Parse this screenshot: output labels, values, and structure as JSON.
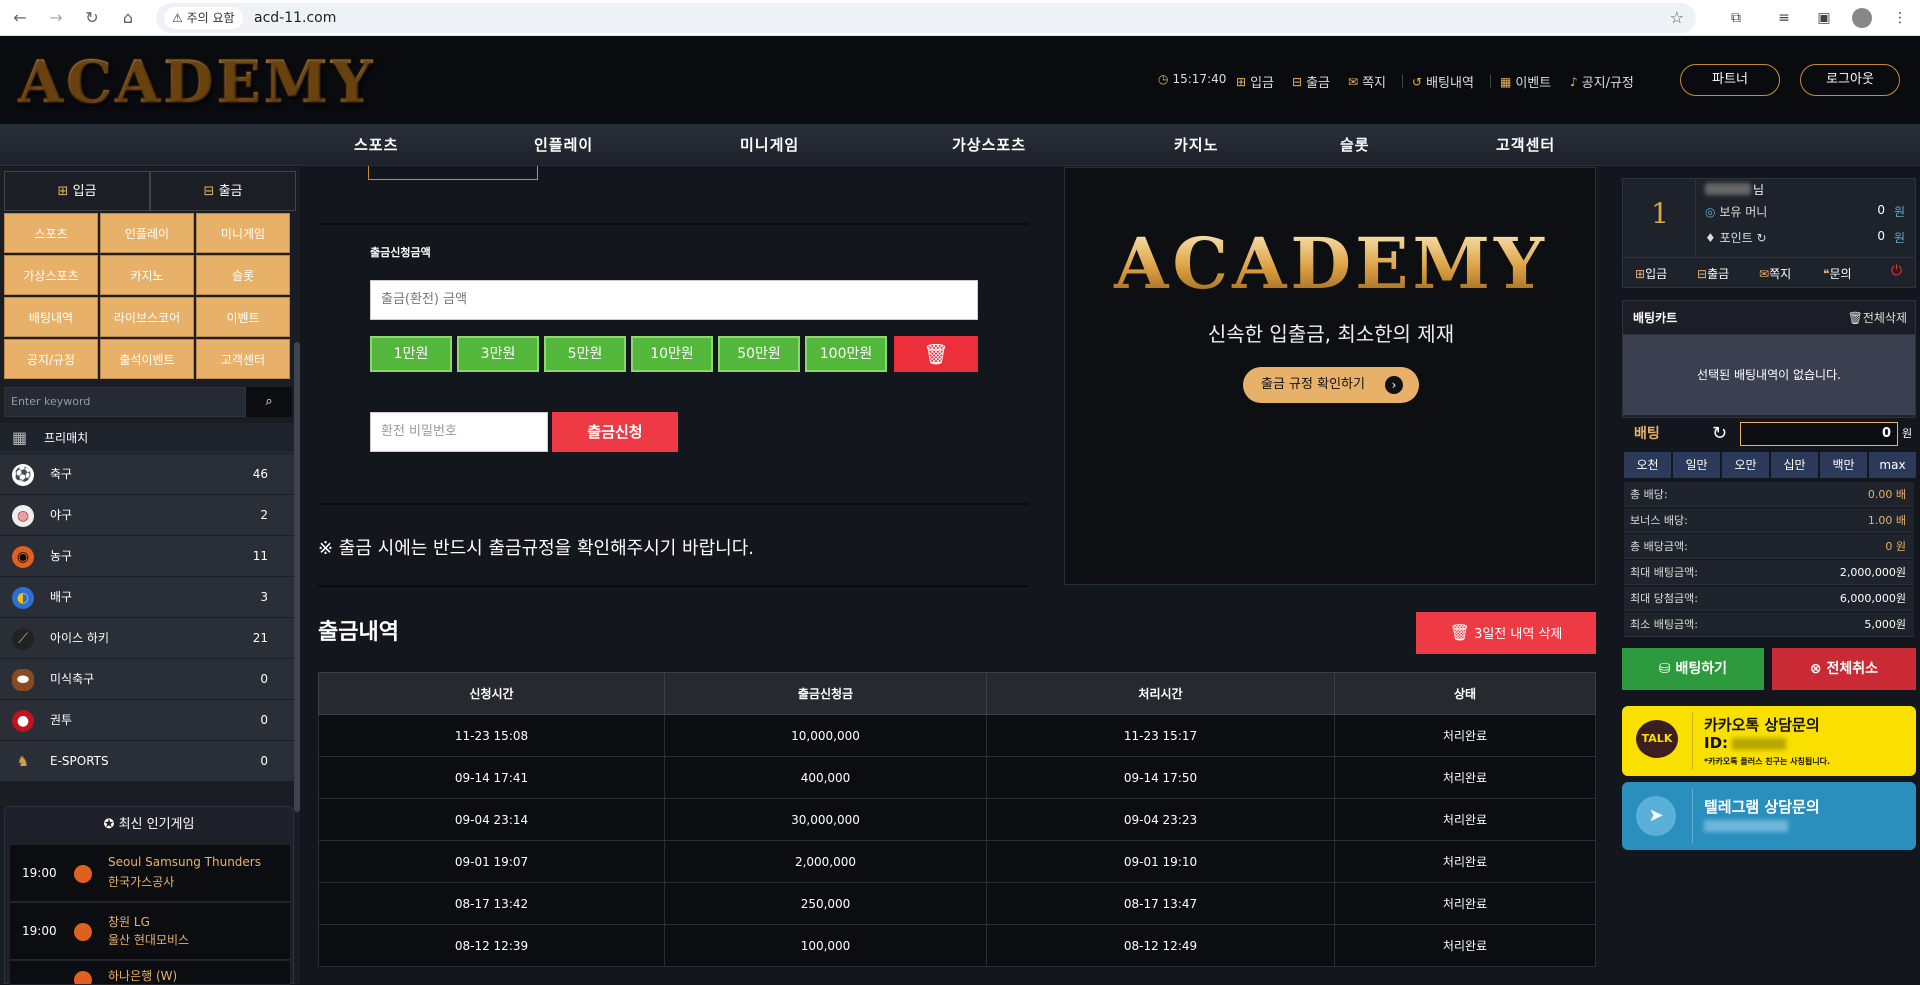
{
  "browser": {
    "warning": "주의 요함",
    "url": "acd-11.com"
  },
  "header": {
    "logo": "ACADEMY",
    "time": "15:17:40",
    "links": [
      "입금",
      "출금",
      "쪽지",
      "배팅내역",
      "이벤트",
      "공지/규정"
    ],
    "partner": "파트너",
    "logout": "로그아웃"
  },
  "nav": [
    "스포츠",
    "인플레이",
    "미니게임",
    "가상스포츠",
    "카지노",
    "슬롯",
    "고객센터"
  ],
  "left": {
    "deposit": "입금",
    "withdraw": "출금",
    "grid": [
      "스포츠",
      "인플레이",
      "미니게임",
      "가상스포츠",
      "카지노",
      "슬롯",
      "배팅내역",
      "라이브스코어",
      "이벤트",
      "공지/규정",
      "출석이벤트",
      "고객센터"
    ],
    "search_placeholder": "Enter keyword",
    "prematch": "프리매치",
    "sports": [
      {
        "name": "축구",
        "count": "46"
      },
      {
        "name": "야구",
        "count": "2"
      },
      {
        "name": "농구",
        "count": "11"
      },
      {
        "name": "배구",
        "count": "3"
      },
      {
        "name": "아이스 하키",
        "count": "21"
      },
      {
        "name": "미식축구",
        "count": "0"
      },
      {
        "name": "권투",
        "count": "0"
      },
      {
        "name": "E-SPORTS",
        "count": "0"
      }
    ],
    "popular_title": "최신 인기게임",
    "popular": [
      {
        "time": "19:00",
        "home": "Seoul Samsung Thunders",
        "away": "한국가스공사"
      },
      {
        "time": "19:00",
        "home": "창원 LG",
        "away": "울산 현대모비스"
      },
      {
        "time": "",
        "home": "하나은행 (W)",
        "away": ""
      }
    ]
  },
  "form": {
    "amount_label": "출금신청금액",
    "amount_placeholder": "출금(환전) 금액",
    "amounts": [
      "1만원",
      "3만원",
      "5만원",
      "10만원",
      "50만원",
      "100만원"
    ],
    "password_placeholder": "환전 비밀번호",
    "submit": "출금신청",
    "notice": "※ 출금 시에는 반드시 출금규정을 확인해주시기 바랍니다."
  },
  "banner": {
    "logo": "ACADEMY",
    "tagline": "신속한 입출금, 최소한의 제재",
    "rules_button": "출금 규정 확인하기"
  },
  "history": {
    "title": "출금내역",
    "delete_button": "3일전 내역 삭제",
    "columns": [
      "신청시간",
      "출금신청금",
      "처리시간",
      "상태"
    ],
    "rows": [
      [
        "11-23 15:08",
        "10,000,000",
        "11-23 15:17",
        "처리완료"
      ],
      [
        "09-14 17:41",
        "400,000",
        "09-14 17:50",
        "처리완료"
      ],
      [
        "09-04 23:14",
        "30,000,000",
        "09-04 23:23",
        "처리완료"
      ],
      [
        "09-01 19:07",
        "2,000,000",
        "09-01 19:10",
        "처리완료"
      ],
      [
        "08-17 13:42",
        "250,000",
        "08-17 13:47",
        "처리완료"
      ],
      [
        "08-12 12:39",
        "100,000",
        "08-12 12:49",
        "처리완료"
      ]
    ]
  },
  "right": {
    "level": "1",
    "user_suffix": "님",
    "money_label": "보유 머니",
    "money_value": "0",
    "money_unit": "원",
    "point_label": "포인트",
    "point_value": "0",
    "point_unit": "원",
    "actions": [
      "입금",
      "출금",
      "쪽지",
      "문의"
    ],
    "betcart_title": "배팅카트",
    "clear_all": "전체삭제",
    "empty_msg": "선택된 배팅내역이 없습니다.",
    "bet_label": "배팅",
    "bet_value": "0",
    "bet_unit": "원",
    "chips": [
      "오천",
      "일만",
      "오만",
      "십만",
      "백만",
      "max"
    ],
    "stats": [
      {
        "k": "총 배당:",
        "v": "0.00 배"
      },
      {
        "k": "보너스 배당:",
        "v": "1.00 배"
      },
      {
        "k": "총 배당금액:",
        "v": "0 원"
      },
      {
        "k": "최대 배팅금액:",
        "v": "2,000,000원"
      },
      {
        "k": "최대 당첨금액:",
        "v": "6,000,000원"
      },
      {
        "k": "최소 배팅금액:",
        "v": "5,000원"
      }
    ],
    "bet_button": "배팅하기",
    "cancel_button": "전체취소",
    "kakao_title": "카카오톡 상담문의",
    "kakao_id": "ID:",
    "kakao_note": "*카카오톡 플러스 친구는 사칭됩니다.",
    "kakao_badge": "TALK",
    "telegram_title": "텔레그램 상담문의"
  },
  "colors": {
    "gold": "#e8b16a",
    "green": "#52b73a",
    "red": "#ee3a44",
    "kakao": "#f9e000",
    "telegram": "#2a8fbd"
  }
}
